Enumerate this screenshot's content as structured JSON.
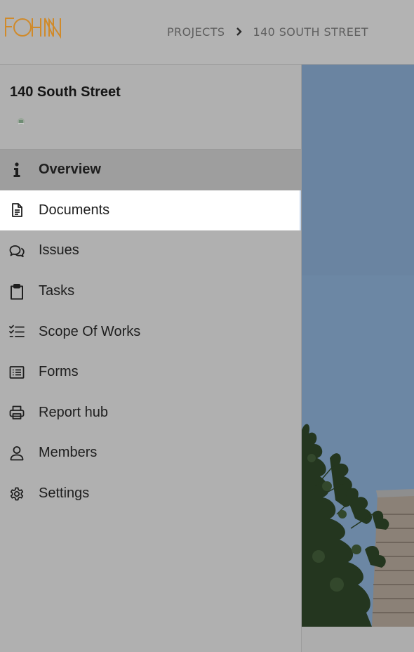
{
  "header": {
    "logo_text": "FOHNN",
    "breadcrumb": [
      {
        "label": "PROJECTS"
      },
      {
        "label": "140 SOUTH STREET"
      }
    ]
  },
  "project": {
    "title": "140 South Street"
  },
  "nav": {
    "items": [
      {
        "label": "Overview",
        "icon": "info-icon",
        "state": "active"
      },
      {
        "label": "Documents",
        "icon": "document-icon",
        "state": "hover"
      },
      {
        "label": "Issues",
        "icon": "chat-bubbles-icon",
        "state": "default"
      },
      {
        "label": "Tasks",
        "icon": "clipboard-icon",
        "state": "default"
      },
      {
        "label": "Scope Of Works",
        "icon": "checklist-icon",
        "state": "default"
      },
      {
        "label": "Forms",
        "icon": "form-list-icon",
        "state": "default"
      },
      {
        "label": "Report hub",
        "icon": "printer-icon",
        "state": "default"
      },
      {
        "label": "Members",
        "icon": "user-icon",
        "state": "default"
      },
      {
        "label": "Settings",
        "icon": "gear-icon",
        "state": "default"
      }
    ]
  },
  "colors": {
    "logo": "#d08a2a",
    "overlay": "#b0b0b0",
    "active_item": "#9e9e9e",
    "highlight_item": "#ffffff",
    "sky": "#6c87a4"
  }
}
